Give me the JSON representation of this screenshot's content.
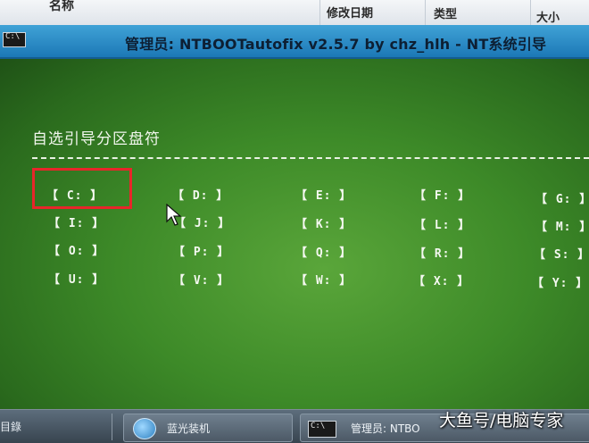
{
  "explorer": {
    "columns": [
      "名称",
      "修改日期",
      "类型",
      "大小"
    ]
  },
  "window": {
    "icon": "C:\\",
    "title": "管理员:  NTBOOTautofix v2.5.7 by chz_hlh - NT系统引导"
  },
  "console": {
    "heading": "自选引导分区盘符",
    "drives": [
      [
        "【 C: 】",
        "【 D: 】",
        "【 E: 】",
        "【 F: 】",
        "【 G: 】"
      ],
      [
        "【 I: 】",
        "【 J: 】",
        "【 K: 】",
        "【 L: 】",
        "【 M: 】"
      ],
      [
        "【 O: 】",
        "【 P: 】",
        "【 Q: 】",
        "【 R: 】",
        "【 S: 】"
      ],
      [
        "【 U: 】",
        "【 V: 】",
        "【 W: 】",
        "【 X: 】",
        "【 Y: 】"
      ]
    ],
    "highlighted_drive": "C:",
    "highlight_color": "#e8262a"
  },
  "taskbar": {
    "left_label": "目錄",
    "items": [
      {
        "icon": "installer-orb-icon",
        "label": "蓝光装机"
      },
      {
        "icon": "cmd-icon",
        "icon_text": "C:\\",
        "label": "管理员:  NTBO"
      }
    ]
  },
  "watermark": "大鱼号/电脑专家",
  "colors": {
    "console_green": "#3d8a28",
    "titlebar_blue": "#1c78b6",
    "text_light": "#f4f8f0"
  }
}
